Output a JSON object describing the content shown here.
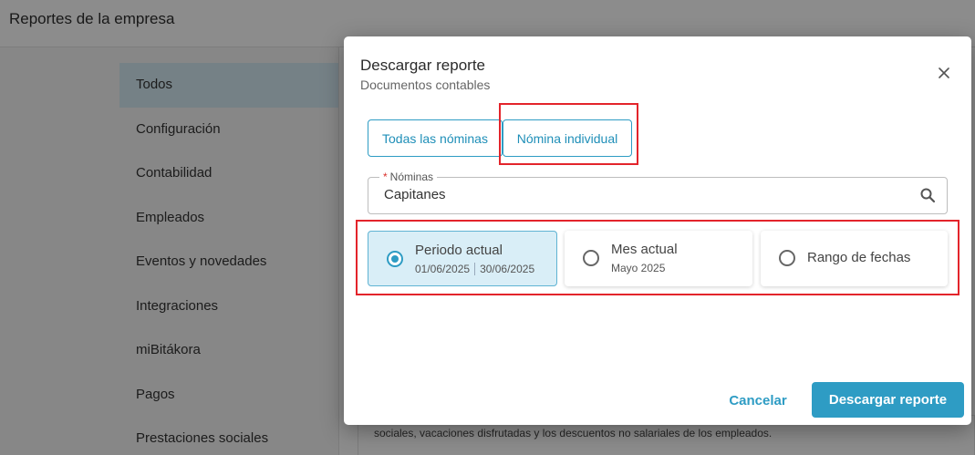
{
  "page": {
    "title": "Reportes de la empresa"
  },
  "sidebar": {
    "items": [
      {
        "label": "Todos",
        "active": true
      },
      {
        "label": "Configuración"
      },
      {
        "label": "Contabilidad"
      },
      {
        "label": "Empleados"
      },
      {
        "label": "Eventos y novedades"
      },
      {
        "label": "Integraciones"
      },
      {
        "label": "miBitákora"
      },
      {
        "label": "Pagos"
      },
      {
        "label": "Prestaciones sociales"
      }
    ]
  },
  "background_card": {
    "description": "sociales, vacaciones disfrutadas y los descuentos no salariales de los empleados."
  },
  "dialog": {
    "title": "Descargar reporte",
    "subtitle": "Documentos contables",
    "close_icon": "close-icon",
    "tabs": [
      {
        "label": "Todas las nóminas"
      },
      {
        "label": "Nómina individual",
        "highlighted": true
      }
    ],
    "nominas_field": {
      "required_mark": "*",
      "label": "Nóminas",
      "value": "Capitanes",
      "icon": "search-icon"
    },
    "period_options": [
      {
        "label": "Periodo actual",
        "start": "01/06/2025",
        "end": "30/06/2025",
        "selected": true
      },
      {
        "label": "Mes actual",
        "sub": "Mayo 2025",
        "selected": false
      },
      {
        "label": "Rango de fechas",
        "selected": false
      }
    ],
    "buttons": {
      "cancel": "Cancelar",
      "download": "Descargar reporte"
    }
  },
  "colors": {
    "accent": "#2e9cc4",
    "selected_bg": "#d9eef7",
    "highlight": "#e3242b",
    "sidebar_active": "#d6ecf5"
  }
}
